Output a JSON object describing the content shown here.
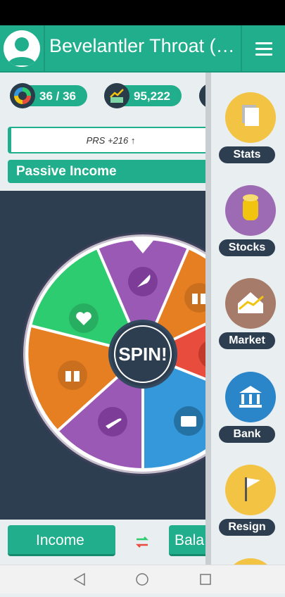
{
  "header": {
    "title": "Bevelantler Throat (G..."
  },
  "stats": {
    "progress": "36 / 36",
    "money": "95,222"
  },
  "prs": "PRS +216 ↑",
  "passive_income": "Passive Income",
  "wheel": {
    "spin_label": "SPIN!",
    "segment_icons": [
      "rocket-icon",
      "gift-icon",
      "dollar-icon",
      "briefcase-icon",
      "rocket-icon",
      "gift-icon",
      "heart-icon"
    ]
  },
  "bottom": {
    "income_label": "Income",
    "balance_label": "Bala"
  },
  "drawer": {
    "items": [
      {
        "label": "Stats",
        "icon": "document-icon",
        "color": "#f3c443"
      },
      {
        "label": "Stocks",
        "icon": "coins-icon",
        "color": "#9d6bb3"
      },
      {
        "label": "Market",
        "icon": "house-icon",
        "color": "#a77b6a"
      },
      {
        "label": "Bank",
        "icon": "bank-icon",
        "color": "#2a86c8"
      },
      {
        "label": "Resign",
        "icon": "flag-icon",
        "color": "#f3c443"
      }
    ]
  }
}
